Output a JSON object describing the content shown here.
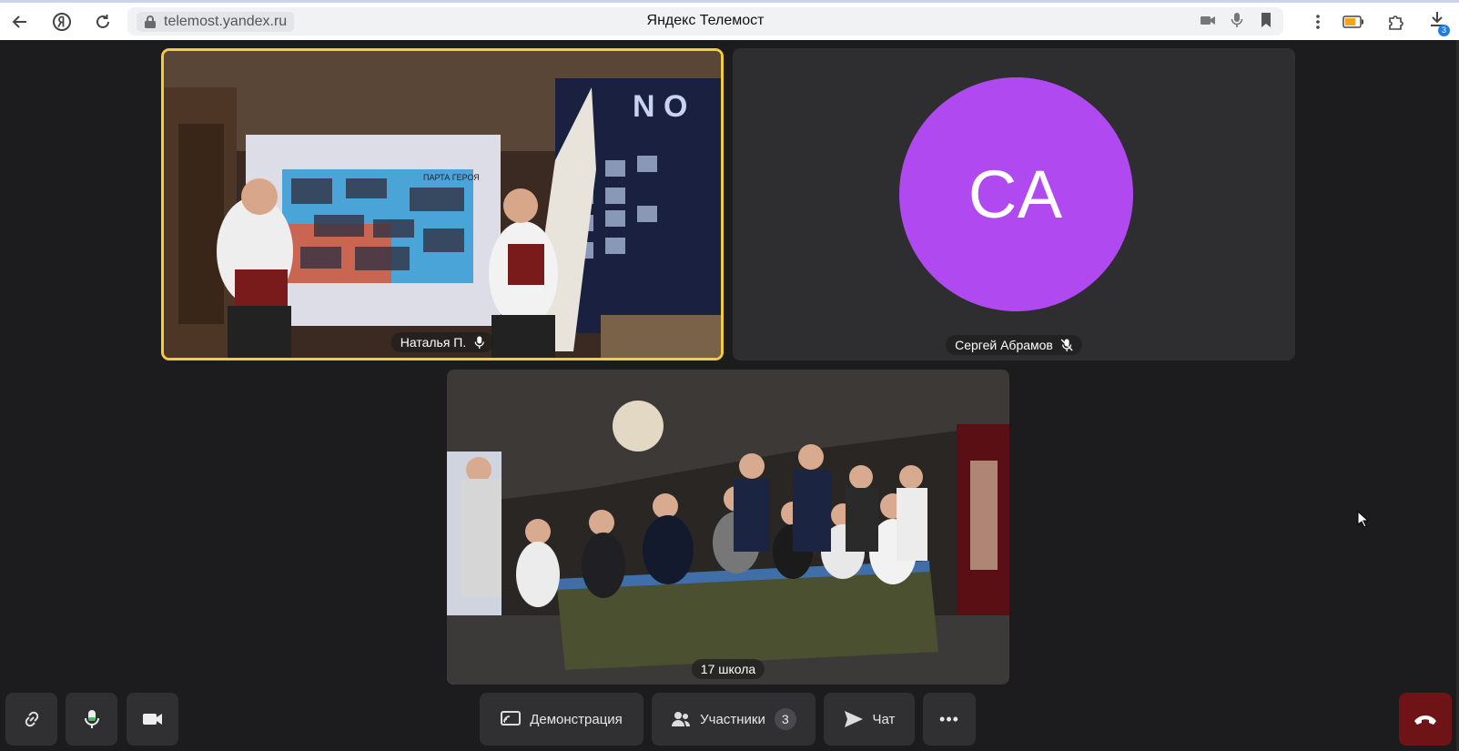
{
  "browser": {
    "url": "telemost.yandex.ru",
    "title": "Яндекс Телемост",
    "downloads_badge": "3"
  },
  "participants": [
    {
      "name": "Наталья П.",
      "mic": "on",
      "speaking": true
    },
    {
      "name": "Сергей Абрамов",
      "mic": "off",
      "initials": "СА",
      "avatar_color": "#b049f0"
    },
    {
      "name": "17 школа"
    }
  ],
  "toolbar": {
    "demo_label": "Демонстрация",
    "participants_label": "Участники",
    "participants_count": "3",
    "chat_label": "Чат",
    "more_label": "•••"
  },
  "colors": {
    "background": "#1c1c1e",
    "active_speaker_border": "#f4cd3c",
    "hangup": "#6e1417"
  }
}
